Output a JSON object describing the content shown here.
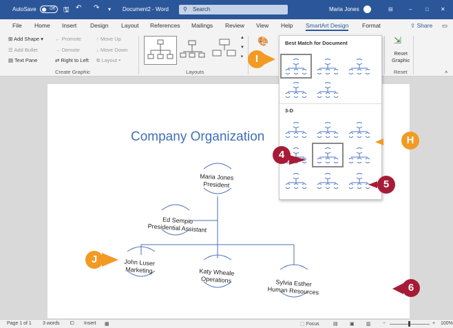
{
  "titlebar": {
    "autosave": "AutoSave",
    "toggle": "Off",
    "document": "Document2 - Word",
    "search": "Search",
    "user": "Maria Jones",
    "minimize": "–",
    "maximize": "□",
    "close": "✕"
  },
  "tabs": [
    "File",
    "Home",
    "Insert",
    "Design",
    "Layout",
    "References",
    "Mailings",
    "Review",
    "View",
    "Help",
    "SmartArt Design",
    "Format"
  ],
  "share": "Share",
  "ribbon": {
    "create_graphic": {
      "add_shape": "Add Shape",
      "add_bullet": "Add Bullet",
      "text_pane": "Text Pane",
      "promote": "Promote",
      "demote": "Demote",
      "right_to_left": "Right to Left",
      "move_up": "Move Up",
      "move_down": "Move Down",
      "layout": "Layout",
      "label": "Create Graphic"
    },
    "layouts_label": "Layouts",
    "reset": {
      "reset_graphic_line1": "Reset",
      "reset_graphic_line2": "Graphic",
      "label": "Reset"
    }
  },
  "gallery": {
    "best_match": "Best Match for Document",
    "three_d": "3-D"
  },
  "document": {
    "title": "Company Organization",
    "nodes": {
      "president_name": "Maria Jones",
      "president_title": "President",
      "assistant_name": "Ed Sempio",
      "assistant_title": "Presidential Assistant",
      "marketing_name": "John Luser",
      "marketing_title": "Marketing",
      "operations_name": "Katy Wheale",
      "operations_title": "Operations",
      "hr_name": "Sylvia Esther",
      "hr_title": "Human Resources"
    }
  },
  "callouts": {
    "I": "I",
    "H": "H",
    "4": "4",
    "5": "5",
    "J": "J",
    "6": "6"
  },
  "statusbar": {
    "page": "Page 1 of 1",
    "words": "3 words",
    "mode": "Insert",
    "focus": "Focus",
    "zoom": "100%"
  },
  "colors": {
    "title_bar": "#2b579a",
    "accent_text": "#3f6fb6",
    "callout_orange": "#f29a23",
    "callout_red": "#a61c37"
  }
}
